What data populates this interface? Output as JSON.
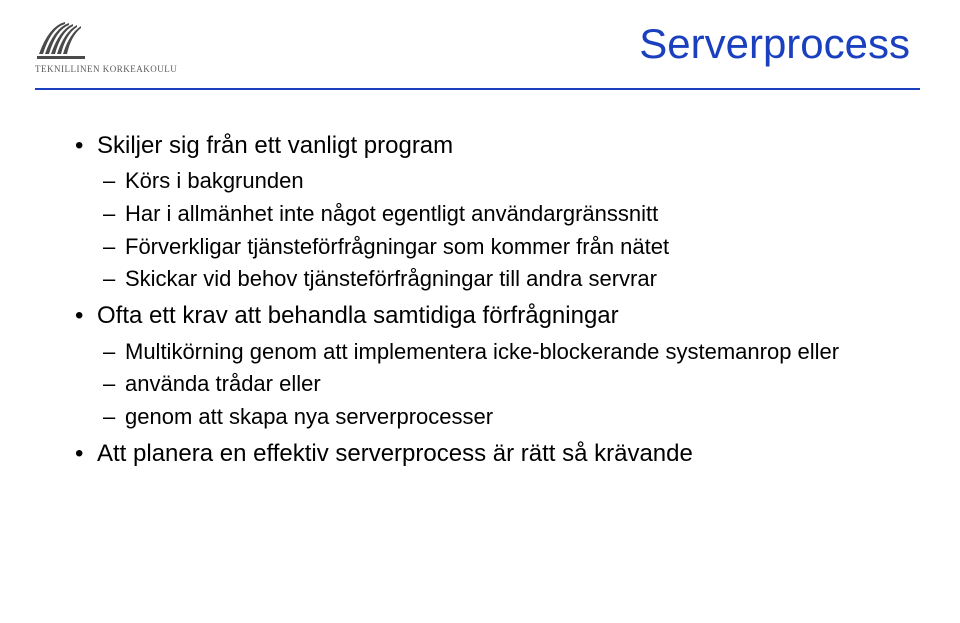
{
  "header": {
    "institution": "TEKNILLINEN KORKEAKOULU",
    "title": "Serverprocess"
  },
  "bullets": {
    "b1": {
      "text": "Skiljer sig från ett vanligt program",
      "sub": {
        "s1": "Körs i bakgrunden",
        "s2": "Har i allmänhet inte något egentligt användargränssnitt",
        "s3": "Förverkligar tjänsteförfrågningar som kommer från nätet",
        "s4": "Skickar vid behov tjänsteförfrågningar till andra servrar"
      }
    },
    "b2": {
      "text": "Ofta ett krav att behandla samtidiga förfrågningar",
      "sub": {
        "s1": "Multikörning genom att implementera icke-blockerande systemanrop eller",
        "s2": "använda trådar eller",
        "s3": "genom att skapa nya serverprocesser"
      }
    },
    "b3": {
      "text": "Att planera en effektiv serverprocess är rätt så krävande"
    }
  }
}
